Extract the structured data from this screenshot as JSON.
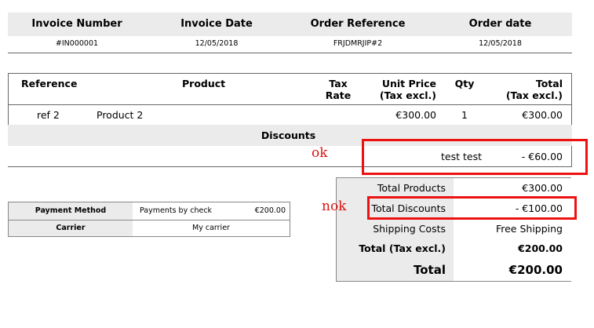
{
  "invoice_header": {
    "columns": [
      "Invoice Number",
      "Invoice Date",
      "Order Reference",
      "Order date"
    ],
    "values": [
      "#IN000001",
      "12/05/2018",
      "FRJDMRJIP#2",
      "12/05/2018"
    ]
  },
  "products": {
    "headers": {
      "reference": "Reference",
      "product": "Product",
      "tax_rate_1": "Tax",
      "tax_rate_2": "Rate",
      "unit_price_1": "Unit Price",
      "unit_price_2": "(Tax excl.)",
      "qty": "Qty",
      "total_1": "Total",
      "total_2": "(Tax excl.)"
    },
    "rows": [
      {
        "reference": "ref 2",
        "product": "Product 2",
        "tax_rate": "",
        "unit_price": "€300.00",
        "qty": "1",
        "total": "€300.00"
      }
    ]
  },
  "discounts": {
    "title": "Discounts",
    "rows": [
      {
        "name": "test test",
        "value": "- €60.00"
      }
    ]
  },
  "payment": {
    "method_label": "Payment Method",
    "method_value": "Payments by check",
    "method_amount": "€200.00",
    "carrier_label": "Carrier",
    "carrier_value": "My carrier"
  },
  "totals": {
    "rows": [
      {
        "label": "Total Products",
        "value": "€300.00"
      },
      {
        "label": "Total Discounts",
        "value": "- €100.00"
      },
      {
        "label": "Shipping Costs",
        "value": "Free Shipping"
      },
      {
        "label": "Total (Tax excl.)",
        "value": "€200.00"
      },
      {
        "label": "Total",
        "value": "€200.00"
      }
    ]
  },
  "annotations": {
    "ok_label": "ok",
    "nok_label": "nok",
    "color": "#ee1111"
  }
}
